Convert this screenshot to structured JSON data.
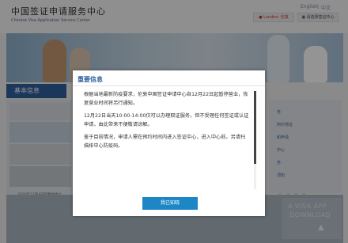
{
  "header": {
    "logo_cn": "中国签证申请服务中心",
    "logo_en": "Chinese Visa Application Service Center",
    "lang_en": "English",
    "lang_zh": "中文",
    "location_button": "London: 伦敦",
    "select_center_button": "请选择签证中心"
  },
  "page": {
    "basic_info_tab": "基本信息",
    "ticker_text": "2020年11月4日起暂时停止…",
    "right_links": [
      "务",
      "阿尔地址",
      "",
      "和申请",
      "中心",
      "务",
      "须知"
    ],
    "app_banner_line1": "A VISA  APP",
    "app_banner_line2": "DOWNLOAD"
  },
  "modal": {
    "title": "重要信息",
    "paragraphs": [
      "根据当地最新防疫要求，伦敦中国签证申请中心自12月22日起暂停营业，恢复营业时间将另行通知。",
      "12月22日当天10:00-14:00仅可以办理取证服务，但不受理任何签证或认证申请，由此带来不便敬请谅解。",
      "鉴于目前情况，申请人需在预约时间内进入签证中心，进入中心前，另请扫描排中心防疫码。"
    ],
    "ok_button": "我已知晓"
  }
}
